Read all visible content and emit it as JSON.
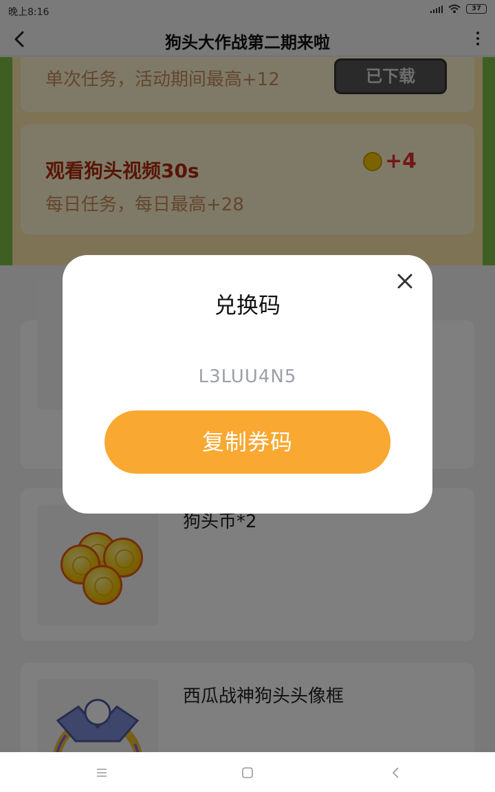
{
  "status_bar": {
    "time": "晚上8:16",
    "battery": "37"
  },
  "navbar": {
    "title": "狗头大作战第二期来啦"
  },
  "tasks": [
    {
      "title": "",
      "subtitle": "单次任务，活动期间最高+12",
      "button_label": "已下载"
    },
    {
      "title": "观看狗头视频30s",
      "subtitle": "每日任务，每日最高+28",
      "reward": "+4"
    }
  ],
  "prizes": [
    {
      "name": ""
    },
    {
      "name": "狗头币*2"
    },
    {
      "name": "西瓜战神狗头头像框"
    }
  ],
  "modal": {
    "title": "兑换码",
    "code": "L3LUU4N5",
    "copy_button": "复制券码"
  },
  "colors": {
    "accent": "#f9a831",
    "header_green": "#7bbf49",
    "task_red": "#b02a0c",
    "reward_red": "#e0322a"
  },
  "icons": [
    "back-arrow-icon",
    "more-vertical-icon",
    "close-icon",
    "coin-icon",
    "menu-icon",
    "home-icon",
    "back-icon",
    "wifi-icon",
    "signal-icon",
    "battery-icon"
  ]
}
